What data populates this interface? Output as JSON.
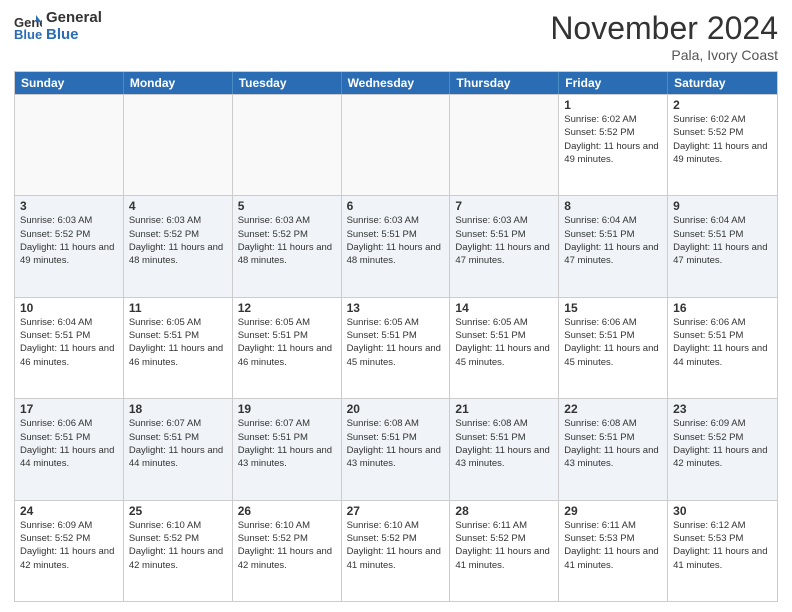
{
  "header": {
    "logo_line1": "General",
    "logo_line2": "Blue",
    "month_title": "November 2024",
    "location": "Pala, Ivory Coast"
  },
  "days_of_week": [
    "Sunday",
    "Monday",
    "Tuesday",
    "Wednesday",
    "Thursday",
    "Friday",
    "Saturday"
  ],
  "weeks": [
    [
      {
        "day": "",
        "empty": true
      },
      {
        "day": "",
        "empty": true
      },
      {
        "day": "",
        "empty": true
      },
      {
        "day": "",
        "empty": true
      },
      {
        "day": "",
        "empty": true
      },
      {
        "day": "1",
        "sunrise": "6:02 AM",
        "sunset": "5:52 PM",
        "daylight": "11 hours and 49 minutes."
      },
      {
        "day": "2",
        "sunrise": "6:02 AM",
        "sunset": "5:52 PM",
        "daylight": "11 hours and 49 minutes."
      }
    ],
    [
      {
        "day": "3",
        "sunrise": "6:03 AM",
        "sunset": "5:52 PM",
        "daylight": "11 hours and 49 minutes."
      },
      {
        "day": "4",
        "sunrise": "6:03 AM",
        "sunset": "5:52 PM",
        "daylight": "11 hours and 48 minutes."
      },
      {
        "day": "5",
        "sunrise": "6:03 AM",
        "sunset": "5:52 PM",
        "daylight": "11 hours and 48 minutes."
      },
      {
        "day": "6",
        "sunrise": "6:03 AM",
        "sunset": "5:51 PM",
        "daylight": "11 hours and 48 minutes."
      },
      {
        "day": "7",
        "sunrise": "6:03 AM",
        "sunset": "5:51 PM",
        "daylight": "11 hours and 47 minutes."
      },
      {
        "day": "8",
        "sunrise": "6:04 AM",
        "sunset": "5:51 PM",
        "daylight": "11 hours and 47 minutes."
      },
      {
        "day": "9",
        "sunrise": "6:04 AM",
        "sunset": "5:51 PM",
        "daylight": "11 hours and 47 minutes."
      }
    ],
    [
      {
        "day": "10",
        "sunrise": "6:04 AM",
        "sunset": "5:51 PM",
        "daylight": "11 hours and 46 minutes."
      },
      {
        "day": "11",
        "sunrise": "6:05 AM",
        "sunset": "5:51 PM",
        "daylight": "11 hours and 46 minutes."
      },
      {
        "day": "12",
        "sunrise": "6:05 AM",
        "sunset": "5:51 PM",
        "daylight": "11 hours and 46 minutes."
      },
      {
        "day": "13",
        "sunrise": "6:05 AM",
        "sunset": "5:51 PM",
        "daylight": "11 hours and 45 minutes."
      },
      {
        "day": "14",
        "sunrise": "6:05 AM",
        "sunset": "5:51 PM",
        "daylight": "11 hours and 45 minutes."
      },
      {
        "day": "15",
        "sunrise": "6:06 AM",
        "sunset": "5:51 PM",
        "daylight": "11 hours and 45 minutes."
      },
      {
        "day": "16",
        "sunrise": "6:06 AM",
        "sunset": "5:51 PM",
        "daylight": "11 hours and 44 minutes."
      }
    ],
    [
      {
        "day": "17",
        "sunrise": "6:06 AM",
        "sunset": "5:51 PM",
        "daylight": "11 hours and 44 minutes."
      },
      {
        "day": "18",
        "sunrise": "6:07 AM",
        "sunset": "5:51 PM",
        "daylight": "11 hours and 44 minutes."
      },
      {
        "day": "19",
        "sunrise": "6:07 AM",
        "sunset": "5:51 PM",
        "daylight": "11 hours and 43 minutes."
      },
      {
        "day": "20",
        "sunrise": "6:08 AM",
        "sunset": "5:51 PM",
        "daylight": "11 hours and 43 minutes."
      },
      {
        "day": "21",
        "sunrise": "6:08 AM",
        "sunset": "5:51 PM",
        "daylight": "11 hours and 43 minutes."
      },
      {
        "day": "22",
        "sunrise": "6:08 AM",
        "sunset": "5:51 PM",
        "daylight": "11 hours and 43 minutes."
      },
      {
        "day": "23",
        "sunrise": "6:09 AM",
        "sunset": "5:52 PM",
        "daylight": "11 hours and 42 minutes."
      }
    ],
    [
      {
        "day": "24",
        "sunrise": "6:09 AM",
        "sunset": "5:52 PM",
        "daylight": "11 hours and 42 minutes."
      },
      {
        "day": "25",
        "sunrise": "6:10 AM",
        "sunset": "5:52 PM",
        "daylight": "11 hours and 42 minutes."
      },
      {
        "day": "26",
        "sunrise": "6:10 AM",
        "sunset": "5:52 PM",
        "daylight": "11 hours and 42 minutes."
      },
      {
        "day": "27",
        "sunrise": "6:10 AM",
        "sunset": "5:52 PM",
        "daylight": "11 hours and 41 minutes."
      },
      {
        "day": "28",
        "sunrise": "6:11 AM",
        "sunset": "5:52 PM",
        "daylight": "11 hours and 41 minutes."
      },
      {
        "day": "29",
        "sunrise": "6:11 AM",
        "sunset": "5:53 PM",
        "daylight": "11 hours and 41 minutes."
      },
      {
        "day": "30",
        "sunrise": "6:12 AM",
        "sunset": "5:53 PM",
        "daylight": "11 hours and 41 minutes."
      }
    ]
  ]
}
